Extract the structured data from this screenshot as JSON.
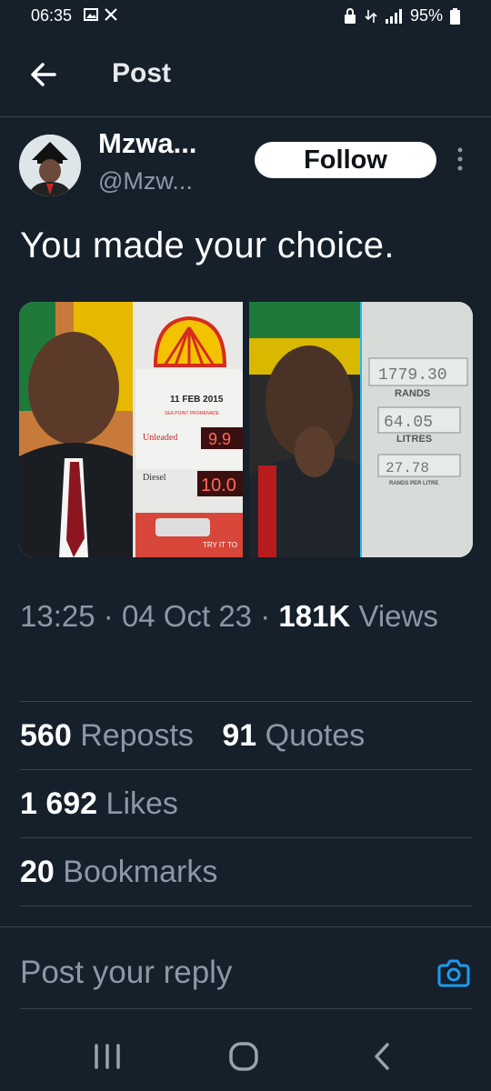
{
  "status": {
    "time": "06:35",
    "battery": "95%"
  },
  "header": {
    "title": "Post"
  },
  "author": {
    "name": "Mzwa...",
    "handle": "@Mzw...",
    "follow_label": "Follow"
  },
  "tweet": {
    "text": "You made your choice."
  },
  "media": {
    "left": {
      "date": "11 FEB 2015",
      "promenade": "SEA POINT PROMENADE",
      "unleaded_label": "Unleaded",
      "unleaded_price": "9.9",
      "diesel_label": "Diesel",
      "diesel_price": "10.0",
      "cta": "TRY IT TO"
    },
    "right": {
      "rands_value": "1779.30",
      "rands_label": "RANDS",
      "litres_value": "64.05",
      "litres_label": "LITRES",
      "per_litre_value": "27.78",
      "per_litre_label": "RANDS PER LITRE"
    }
  },
  "meta": {
    "time": "13:25",
    "date": "04 Oct 23",
    "views_count": "181K",
    "views_label": "Views"
  },
  "stats": {
    "reposts_count": "560",
    "reposts_label": "Reposts",
    "quotes_count": "91",
    "quotes_label": "Quotes",
    "likes_count": "1 692",
    "likes_label": "Likes",
    "bookmarks_count": "20",
    "bookmarks_label": "Bookmarks"
  },
  "reply": {
    "placeholder": "Post your reply"
  },
  "colors": {
    "background": "#15202b",
    "accent": "#1d9bf0",
    "muted": "#8b98a5"
  }
}
